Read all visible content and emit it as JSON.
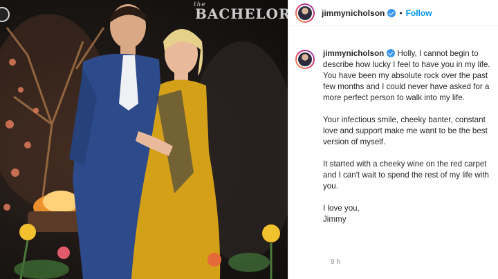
{
  "photo": {
    "watermark_prefix": "the",
    "watermark": "BACHELOR"
  },
  "post": {
    "username": "jimmynicholson",
    "separator": "•",
    "follow_label": "Follow"
  },
  "caption": {
    "username": "jimmynicholson",
    "paragraphs": [
      "Holly, I cannot begin to describe how lucky I feel to have you in my life. You have been my absolute rock over the past few months and I could never have asked for a more perfect person to walk into my life.",
      "Your infectious smile, cheeky banter, constant love and support make me want to be the best version of myself.",
      "It started with a cheeky wine on the red carpet and I can't wait to spend the rest of my life with you."
    ],
    "signoff_line1": "I love you,",
    "signoff_line2": "Jimmy"
  },
  "timestamp": "9 h",
  "colors": {
    "link_blue": "#0095f6",
    "verified_blue": "#3897f0",
    "dress_gold": "#d4a017",
    "suit_blue": "#2d4a8a"
  }
}
